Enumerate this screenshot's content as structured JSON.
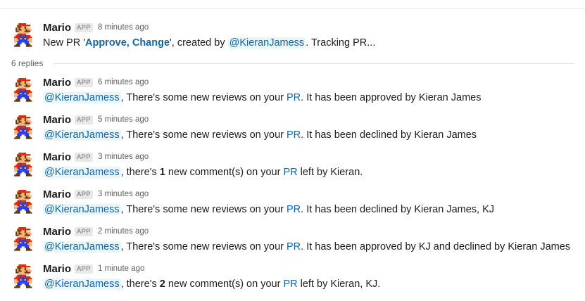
{
  "parent": {
    "sender": "Mario",
    "badge": "APP",
    "time": "8 minutes ago",
    "text_prefix": "New PR '",
    "pr_title": "Approve, Change",
    "text_mid": "', created by ",
    "mention": "@KieranJamess",
    "text_suffix": ". Tracking PR..."
  },
  "replies_label": "6 replies",
  "replies": [
    {
      "sender": "Mario",
      "badge": "APP",
      "time": "6 minutes ago",
      "mention": "@KieranJamess",
      "text_a": ", There's some new reviews on your ",
      "link": "PR",
      "text_b": ". It has been approved by Kieran James"
    },
    {
      "sender": "Mario",
      "badge": "APP",
      "time": "5 minutes ago",
      "mention": "@KieranJamess",
      "text_a": ", There's some new reviews on your ",
      "link": "PR",
      "text_b": ". It has been declined by Kieran James"
    },
    {
      "sender": "Mario",
      "badge": "APP",
      "time": "3 minutes ago",
      "mention": "@KieranJamess",
      "text_a": ", there's ",
      "count": "1",
      "text_c": " new comment(s) on your ",
      "link": "PR",
      "text_b": " left by Kieran."
    },
    {
      "sender": "Mario",
      "badge": "APP",
      "time": "3 minutes ago",
      "mention": "@KieranJamess",
      "text_a": ", There's some new reviews on your ",
      "link": "PR",
      "text_b": ". It has been declined by Kieran James, KJ"
    },
    {
      "sender": "Mario",
      "badge": "APP",
      "time": "2 minutes ago",
      "mention": "@KieranJamess",
      "text_a": ", There's some new reviews on your ",
      "link": "PR",
      "text_b": ". It has been approved by KJ and declined by Kieran James"
    },
    {
      "sender": "Mario",
      "badge": "APP",
      "time": "1 minute ago",
      "mention": "@KieranJamess",
      "text_a": ", there's ",
      "count": "2",
      "text_c": " new comment(s) on your ",
      "link": "PR",
      "text_b": " left by Kieran, KJ."
    }
  ],
  "avatar_icon": "mario-avatar-icon",
  "colors": {
    "link": "#1264a3",
    "mention_bg": "#e8f5fa",
    "badge_bg": "#e8e8e8",
    "meta_text": "#616061"
  }
}
